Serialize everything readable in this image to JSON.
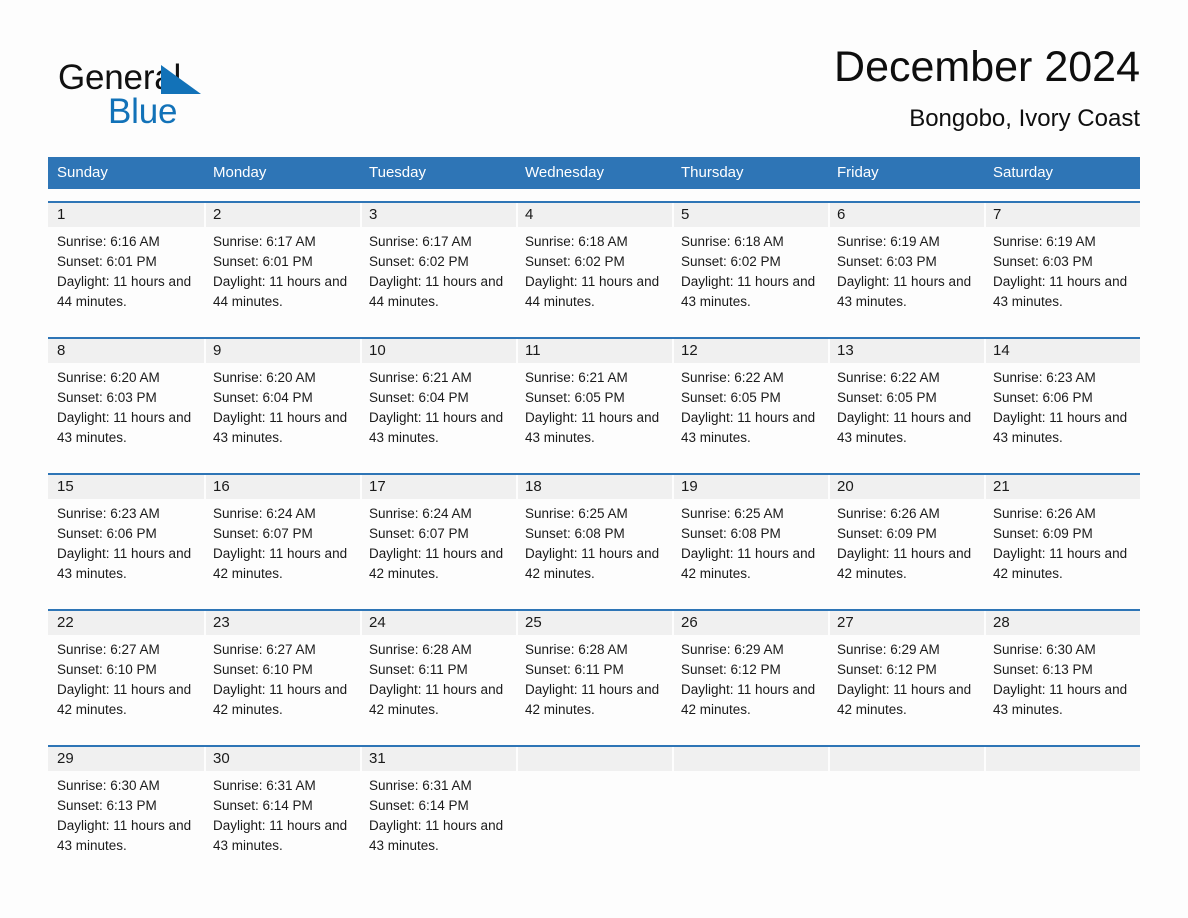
{
  "brand": {
    "name_part1": "General",
    "name_part2": "Blue",
    "triangle_color": "#1272b8"
  },
  "header": {
    "month_title": "December 2024",
    "location": "Bongobo, Ivory Coast"
  },
  "theme": {
    "header_bar_color": "#2e75b6",
    "row_divider_color": "#2e75b6",
    "daynum_band_color": "#f0f0f0",
    "page_background": "#fdfdfd",
    "text_color": "#1a1a1a"
  },
  "weekdays": [
    "Sunday",
    "Monday",
    "Tuesday",
    "Wednesday",
    "Thursday",
    "Friday",
    "Saturday"
  ],
  "weeks": [
    [
      {
        "day": "1",
        "sunrise": "Sunrise: 6:16 AM",
        "sunset": "Sunset: 6:01 PM",
        "daylight": "Daylight: 11 hours and 44 minutes."
      },
      {
        "day": "2",
        "sunrise": "Sunrise: 6:17 AM",
        "sunset": "Sunset: 6:01 PM",
        "daylight": "Daylight: 11 hours and 44 minutes."
      },
      {
        "day": "3",
        "sunrise": "Sunrise: 6:17 AM",
        "sunset": "Sunset: 6:02 PM",
        "daylight": "Daylight: 11 hours and 44 minutes."
      },
      {
        "day": "4",
        "sunrise": "Sunrise: 6:18 AM",
        "sunset": "Sunset: 6:02 PM",
        "daylight": "Daylight: 11 hours and 44 minutes."
      },
      {
        "day": "5",
        "sunrise": "Sunrise: 6:18 AM",
        "sunset": "Sunset: 6:02 PM",
        "daylight": "Daylight: 11 hours and 43 minutes."
      },
      {
        "day": "6",
        "sunrise": "Sunrise: 6:19 AM",
        "sunset": "Sunset: 6:03 PM",
        "daylight": "Daylight: 11 hours and 43 minutes."
      },
      {
        "day": "7",
        "sunrise": "Sunrise: 6:19 AM",
        "sunset": "Sunset: 6:03 PM",
        "daylight": "Daylight: 11 hours and 43 minutes."
      }
    ],
    [
      {
        "day": "8",
        "sunrise": "Sunrise: 6:20 AM",
        "sunset": "Sunset: 6:03 PM",
        "daylight": "Daylight: 11 hours and 43 minutes."
      },
      {
        "day": "9",
        "sunrise": "Sunrise: 6:20 AM",
        "sunset": "Sunset: 6:04 PM",
        "daylight": "Daylight: 11 hours and 43 minutes."
      },
      {
        "day": "10",
        "sunrise": "Sunrise: 6:21 AM",
        "sunset": "Sunset: 6:04 PM",
        "daylight": "Daylight: 11 hours and 43 minutes."
      },
      {
        "day": "11",
        "sunrise": "Sunrise: 6:21 AM",
        "sunset": "Sunset: 6:05 PM",
        "daylight": "Daylight: 11 hours and 43 minutes."
      },
      {
        "day": "12",
        "sunrise": "Sunrise: 6:22 AM",
        "sunset": "Sunset: 6:05 PM",
        "daylight": "Daylight: 11 hours and 43 minutes."
      },
      {
        "day": "13",
        "sunrise": "Sunrise: 6:22 AM",
        "sunset": "Sunset: 6:05 PM",
        "daylight": "Daylight: 11 hours and 43 minutes."
      },
      {
        "day": "14",
        "sunrise": "Sunrise: 6:23 AM",
        "sunset": "Sunset: 6:06 PM",
        "daylight": "Daylight: 11 hours and 43 minutes."
      }
    ],
    [
      {
        "day": "15",
        "sunrise": "Sunrise: 6:23 AM",
        "sunset": "Sunset: 6:06 PM",
        "daylight": "Daylight: 11 hours and 43 minutes."
      },
      {
        "day": "16",
        "sunrise": "Sunrise: 6:24 AM",
        "sunset": "Sunset: 6:07 PM",
        "daylight": "Daylight: 11 hours and 42 minutes."
      },
      {
        "day": "17",
        "sunrise": "Sunrise: 6:24 AM",
        "sunset": "Sunset: 6:07 PM",
        "daylight": "Daylight: 11 hours and 42 minutes."
      },
      {
        "day": "18",
        "sunrise": "Sunrise: 6:25 AM",
        "sunset": "Sunset: 6:08 PM",
        "daylight": "Daylight: 11 hours and 42 minutes."
      },
      {
        "day": "19",
        "sunrise": "Sunrise: 6:25 AM",
        "sunset": "Sunset: 6:08 PM",
        "daylight": "Daylight: 11 hours and 42 minutes."
      },
      {
        "day": "20",
        "sunrise": "Sunrise: 6:26 AM",
        "sunset": "Sunset: 6:09 PM",
        "daylight": "Daylight: 11 hours and 42 minutes."
      },
      {
        "day": "21",
        "sunrise": "Sunrise: 6:26 AM",
        "sunset": "Sunset: 6:09 PM",
        "daylight": "Daylight: 11 hours and 42 minutes."
      }
    ],
    [
      {
        "day": "22",
        "sunrise": "Sunrise: 6:27 AM",
        "sunset": "Sunset: 6:10 PM",
        "daylight": "Daylight: 11 hours and 42 minutes."
      },
      {
        "day": "23",
        "sunrise": "Sunrise: 6:27 AM",
        "sunset": "Sunset: 6:10 PM",
        "daylight": "Daylight: 11 hours and 42 minutes."
      },
      {
        "day": "24",
        "sunrise": "Sunrise: 6:28 AM",
        "sunset": "Sunset: 6:11 PM",
        "daylight": "Daylight: 11 hours and 42 minutes."
      },
      {
        "day": "25",
        "sunrise": "Sunrise: 6:28 AM",
        "sunset": "Sunset: 6:11 PM",
        "daylight": "Daylight: 11 hours and 42 minutes."
      },
      {
        "day": "26",
        "sunrise": "Sunrise: 6:29 AM",
        "sunset": "Sunset: 6:12 PM",
        "daylight": "Daylight: 11 hours and 42 minutes."
      },
      {
        "day": "27",
        "sunrise": "Sunrise: 6:29 AM",
        "sunset": "Sunset: 6:12 PM",
        "daylight": "Daylight: 11 hours and 42 minutes."
      },
      {
        "day": "28",
        "sunrise": "Sunrise: 6:30 AM",
        "sunset": "Sunset: 6:13 PM",
        "daylight": "Daylight: 11 hours and 43 minutes."
      }
    ],
    [
      {
        "day": "29",
        "sunrise": "Sunrise: 6:30 AM",
        "sunset": "Sunset: 6:13 PM",
        "daylight": "Daylight: 11 hours and 43 minutes."
      },
      {
        "day": "30",
        "sunrise": "Sunrise: 6:31 AM",
        "sunset": "Sunset: 6:14 PM",
        "daylight": "Daylight: 11 hours and 43 minutes."
      },
      {
        "day": "31",
        "sunrise": "Sunrise: 6:31 AM",
        "sunset": "Sunset: 6:14 PM",
        "daylight": "Daylight: 11 hours and 43 minutes."
      },
      {
        "day": "",
        "sunrise": "",
        "sunset": "",
        "daylight": ""
      },
      {
        "day": "",
        "sunrise": "",
        "sunset": "",
        "daylight": ""
      },
      {
        "day": "",
        "sunrise": "",
        "sunset": "",
        "daylight": ""
      },
      {
        "day": "",
        "sunrise": "",
        "sunset": "",
        "daylight": ""
      }
    ]
  ]
}
